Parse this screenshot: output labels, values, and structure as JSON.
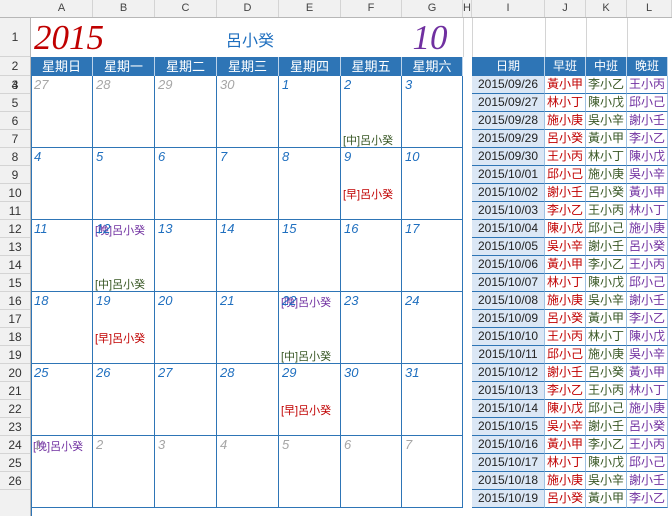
{
  "columns": [
    "A",
    "B",
    "C",
    "D",
    "E",
    "F",
    "G",
    "H",
    "I",
    "J",
    "K",
    "L"
  ],
  "rows": [
    "1",
    "2",
    "3",
    "4",
    "5",
    "6",
    "7",
    "8",
    "9",
    "10",
    "11",
    "12",
    "13",
    "14",
    "15",
    "16",
    "17",
    "18",
    "19",
    "20",
    "21",
    "22",
    "23",
    "24",
    "25",
    "26"
  ],
  "year": "2015",
  "month": "10",
  "person": "呂小癸",
  "weekdays": [
    "星期日",
    "星期一",
    "星期二",
    "星期三",
    "星期四",
    "星期五",
    "星期六"
  ],
  "colors": {
    "header_blue": "#2e75b6",
    "date_blue": "#1f6fbf",
    "date_gray": "#a6a6a6",
    "early": "#c00000",
    "mid": "#375623",
    "late": "#7030a0"
  },
  "calendar": [
    [
      {
        "d": "27",
        "in": false
      },
      {
        "d": "28",
        "in": false
      },
      {
        "d": "29",
        "in": false
      },
      {
        "d": "30",
        "in": false
      },
      {
        "d": "1",
        "in": true
      },
      {
        "d": "2",
        "in": true,
        "shift": "[中]呂小癸",
        "type": "mid",
        "row": 3
      },
      {
        "d": "3",
        "in": true
      }
    ],
    [
      {
        "d": "4",
        "in": true
      },
      {
        "d": "5",
        "in": true,
        "shift": "[晚]呂小癸",
        "type": "late",
        "row": 4
      },
      {
        "d": "6",
        "in": true
      },
      {
        "d": "7",
        "in": true
      },
      {
        "d": "8",
        "in": true
      },
      {
        "d": "9",
        "in": true,
        "shift": "[早]呂小癸",
        "type": "early",
        "row": 2
      },
      {
        "d": "10",
        "in": true
      }
    ],
    [
      {
        "d": "11",
        "in": true
      },
      {
        "d": "12",
        "in": true,
        "shift": "[中]呂小癸",
        "type": "mid",
        "row": 3
      },
      {
        "d": "13",
        "in": true
      },
      {
        "d": "14",
        "in": true
      },
      {
        "d": "15",
        "in": true,
        "shift": "[晚]呂小癸",
        "type": "late",
        "row": 4
      },
      {
        "d": "16",
        "in": true
      },
      {
        "d": "17",
        "in": true
      }
    ],
    [
      {
        "d": "18",
        "in": true
      },
      {
        "d": "19",
        "in": true,
        "shift": "[早]呂小癸",
        "type": "early",
        "row": 2
      },
      {
        "d": "20",
        "in": true
      },
      {
        "d": "21",
        "in": true
      },
      {
        "d": "22",
        "in": true,
        "shift": "[中]呂小癸",
        "type": "mid",
        "row": 3
      },
      {
        "d": "23",
        "in": true
      },
      {
        "d": "24",
        "in": true
      }
    ],
    [
      {
        "d": "25",
        "in": true,
        "shift": "[晚]呂小癸",
        "type": "late",
        "row": 4
      },
      {
        "d": "26",
        "in": true
      },
      {
        "d": "27",
        "in": true
      },
      {
        "d": "28",
        "in": true
      },
      {
        "d": "29",
        "in": true,
        "shift": "[早]呂小癸",
        "type": "early",
        "row": 2
      },
      {
        "d": "30",
        "in": true
      },
      {
        "d": "31",
        "in": true
      }
    ],
    [
      {
        "d": "1",
        "in": false
      },
      {
        "d": "2",
        "in": false
      },
      {
        "d": "3",
        "in": false
      },
      {
        "d": "4",
        "in": false
      },
      {
        "d": "5",
        "in": false
      },
      {
        "d": "6",
        "in": false
      },
      {
        "d": "7",
        "in": false
      }
    ]
  ],
  "schedule_headers": [
    "日期",
    "早班",
    "中班",
    "晚班"
  ],
  "schedule": [
    [
      "2015/09/26",
      "黃小甲",
      "李小乙",
      "王小丙"
    ],
    [
      "2015/09/27",
      "林小丁",
      "陳小戊",
      "邱小己"
    ],
    [
      "2015/09/28",
      "施小庚",
      "吳小辛",
      "謝小壬"
    ],
    [
      "2015/09/29",
      "呂小癸",
      "黃小甲",
      "李小乙"
    ],
    [
      "2015/09/30",
      "王小丙",
      "林小丁",
      "陳小戊"
    ],
    [
      "2015/10/01",
      "邱小己",
      "施小庚",
      "吳小辛"
    ],
    [
      "2015/10/02",
      "謝小壬",
      "呂小癸",
      "黃小甲"
    ],
    [
      "2015/10/03",
      "李小乙",
      "王小丙",
      "林小丁"
    ],
    [
      "2015/10/04",
      "陳小戊",
      "邱小己",
      "施小庚"
    ],
    [
      "2015/10/05",
      "吳小辛",
      "謝小壬",
      "呂小癸"
    ],
    [
      "2015/10/06",
      "黃小甲",
      "李小乙",
      "王小丙"
    ],
    [
      "2015/10/07",
      "林小丁",
      "陳小戊",
      "邱小己"
    ],
    [
      "2015/10/08",
      "施小庚",
      "吳小辛",
      "謝小壬"
    ],
    [
      "2015/10/09",
      "呂小癸",
      "黃小甲",
      "李小乙"
    ],
    [
      "2015/10/10",
      "王小丙",
      "林小丁",
      "陳小戊"
    ],
    [
      "2015/10/11",
      "邱小己",
      "施小庚",
      "吳小辛"
    ],
    [
      "2015/10/12",
      "謝小壬",
      "呂小癸",
      "黃小甲"
    ],
    [
      "2015/10/13",
      "李小乙",
      "王小丙",
      "林小丁"
    ],
    [
      "2015/10/14",
      "陳小戊",
      "邱小己",
      "施小庚"
    ],
    [
      "2015/10/15",
      "吳小辛",
      "謝小壬",
      "呂小癸"
    ],
    [
      "2015/10/16",
      "黃小甲",
      "李小乙",
      "王小丙"
    ],
    [
      "2015/10/17",
      "林小丁",
      "陳小戊",
      "邱小己"
    ],
    [
      "2015/10/18",
      "施小庚",
      "吳小辛",
      "謝小壬"
    ],
    [
      "2015/10/19",
      "呂小癸",
      "黃小甲",
      "李小乙"
    ]
  ]
}
